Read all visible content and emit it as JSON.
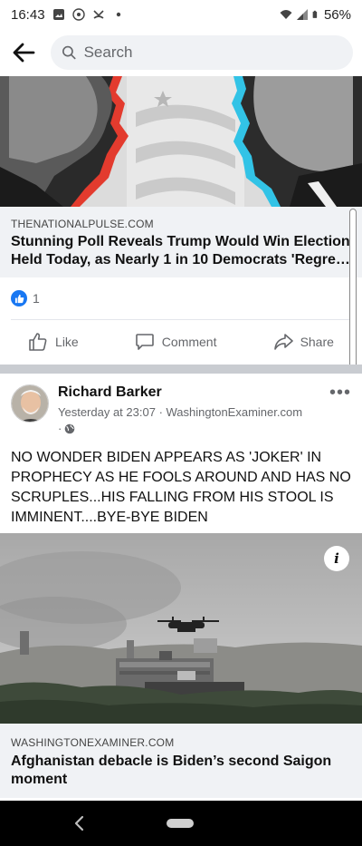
{
  "status_bar": {
    "time": "16:43",
    "battery": "56%",
    "icons": [
      "gallery-icon",
      "vpn-icon",
      "missed-call-icon",
      "dot-icon",
      "wifi-icon",
      "signal-icon",
      "battery-icon"
    ]
  },
  "header": {
    "back_icon": "arrow-left-icon",
    "search_placeholder": "Search"
  },
  "posts": [
    {
      "link": {
        "domain": "THENATIONALPULSE.COM",
        "title": "Stunning Poll Reveals Trump Would Win Election Held Today, as Nearly 1 in 10 Democrats 'Regret' Biden Vote"
      },
      "reaction_count": "1",
      "actions": {
        "like": "Like",
        "comment": "Comment",
        "share": "Share"
      }
    },
    {
      "author": "Richard Barker",
      "timestamp": "Yesterday at 23:07",
      "source": "WashingtonExaminer.com",
      "privacy": "public-globe-icon",
      "text": "NO WONDER BIDEN APPEARS AS 'JOKER' IN PROPHECY AS HE FOOLS AROUND AND HAS NO SCRUPLES...HIS FALLING FROM HIS STOOL IS IMMINENT....BYE-BYE BIDEN",
      "info_label": "i",
      "link": {
        "domain": "WASHINGTONEXAMINER.COM",
        "title": "Afghanistan debacle is Biden’s second Saigon moment"
      }
    }
  ],
  "colors": {
    "brand": "#1877f2",
    "meta_bg": "#f0f2f5",
    "separator": "#c9ccd1"
  }
}
